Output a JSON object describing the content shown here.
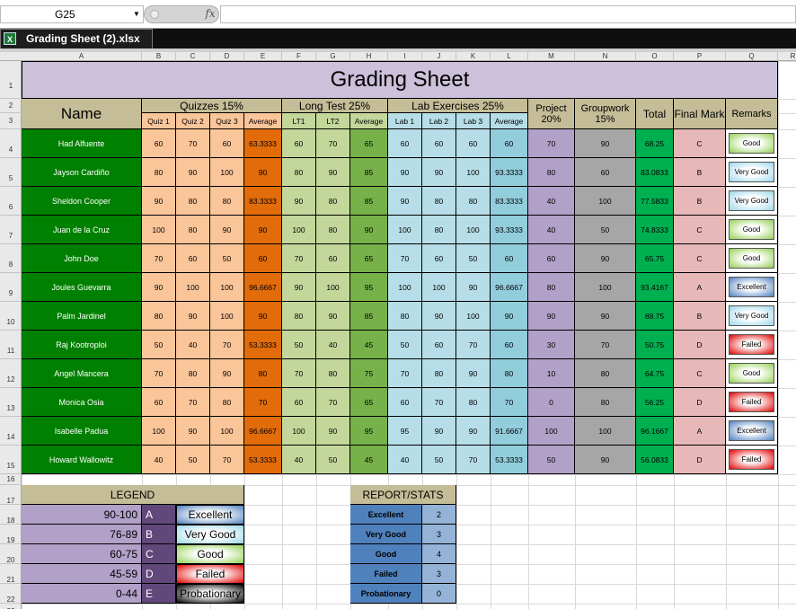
{
  "formula_bar": {
    "name_box": "G25",
    "fx_symbol": "fx",
    "formula": ""
  },
  "tab": {
    "icon": "X",
    "title": "Grading Sheet (2).xlsx"
  },
  "columns": [
    "A",
    "B",
    "C",
    "D",
    "E",
    "F",
    "G",
    "H",
    "I",
    "J",
    "K",
    "L",
    "M",
    "N",
    "O",
    "P",
    "Q",
    "R"
  ],
  "rows": [
    "1",
    "2",
    "3",
    "4",
    "5",
    "6",
    "7",
    "8",
    "9",
    "10",
    "11",
    "12",
    "13",
    "14",
    "15",
    "16",
    "17",
    "18",
    "19",
    "20",
    "21",
    "22",
    "23"
  ],
  "sheet": {
    "title": "Grading Sheet",
    "name_header": "Name",
    "quizzes_header": "Quizzes 15%",
    "long_test_header": "Long Test 25%",
    "lab_header": "Lab Exercises 25%",
    "project_header": "Project",
    "project_pct": "20%",
    "groupwork_header": "Groupwork",
    "groupwork_pct": "15%",
    "total_header": "Total",
    "final_mark_header": "Final Mark",
    "remarks_header": "Remarks",
    "subheaders": [
      "Quiz 1",
      "Quiz 2",
      "Quiz 3",
      "Average",
      "LT1",
      "LT2",
      "Average",
      "Lab 1",
      "Lab 2",
      "Lab 3",
      "Average"
    ],
    "students": [
      {
        "name": "Had Alfuente",
        "q1": "60",
        "q2": "70",
        "q3": "60",
        "qavg": "63.3333",
        "lt1": "60",
        "lt2": "70",
        "ltavg": "65",
        "l1": "60",
        "l2": "60",
        "l3": "60",
        "lavg": "60",
        "proj": "70",
        "gw": "90",
        "total": "68.25",
        "mark": "C",
        "remark": "Good",
        "rclass": "b-good"
      },
      {
        "name": "Jayson Cardiño",
        "q1": "80",
        "q2": "90",
        "q3": "100",
        "qavg": "90",
        "lt1": "80",
        "lt2": "90",
        "ltavg": "85",
        "l1": "90",
        "l2": "90",
        "l3": "100",
        "lavg": "93.3333",
        "proj": "80",
        "gw": "60",
        "total": "83.0833",
        "mark": "B",
        "remark": "Very Good",
        "rclass": "b-vgood"
      },
      {
        "name": "Sheldon Cooper",
        "q1": "90",
        "q2": "80",
        "q3": "80",
        "qavg": "83.3333",
        "lt1": "90",
        "lt2": "80",
        "ltavg": "85",
        "l1": "90",
        "l2": "80",
        "l3": "80",
        "lavg": "83.3333",
        "proj": "40",
        "gw": "100",
        "total": "77.5833",
        "mark": "B",
        "remark": "Very Good",
        "rclass": "b-vgood"
      },
      {
        "name": "Juan de la Cruz",
        "q1": "100",
        "q2": "80",
        "q3": "90",
        "qavg": "90",
        "lt1": "100",
        "lt2": "80",
        "ltavg": "90",
        "l1": "100",
        "l2": "80",
        "l3": "100",
        "lavg": "93.3333",
        "proj": "40",
        "gw": "50",
        "total": "74.8333",
        "mark": "C",
        "remark": "Good",
        "rclass": "b-good"
      },
      {
        "name": "John Doe",
        "q1": "70",
        "q2": "60",
        "q3": "50",
        "qavg": "60",
        "lt1": "70",
        "lt2": "60",
        "ltavg": "65",
        "l1": "70",
        "l2": "60",
        "l3": "50",
        "lavg": "60",
        "proj": "60",
        "gw": "90",
        "total": "65.75",
        "mark": "C",
        "remark": "Good",
        "rclass": "b-good"
      },
      {
        "name": "Joules Guevarra",
        "q1": "90",
        "q2": "100",
        "q3": "100",
        "qavg": "96.6667",
        "lt1": "90",
        "lt2": "100",
        "ltavg": "95",
        "l1": "100",
        "l2": "100",
        "l3": "90",
        "lavg": "96.6667",
        "proj": "80",
        "gw": "100",
        "total": "93.4167",
        "mark": "A",
        "remark": "Excellent",
        "rclass": "b-exc"
      },
      {
        "name": "Palm Jardinel",
        "q1": "80",
        "q2": "90",
        "q3": "100",
        "qavg": "90",
        "lt1": "80",
        "lt2": "90",
        "ltavg": "85",
        "l1": "80",
        "l2": "90",
        "l3": "100",
        "lavg": "90",
        "proj": "90",
        "gw": "90",
        "total": "88.75",
        "mark": "B",
        "remark": "Very Good",
        "rclass": "b-vgood"
      },
      {
        "name": "Raj Kootroploi",
        "q1": "50",
        "q2": "40",
        "q3": "70",
        "qavg": "53.3333",
        "lt1": "50",
        "lt2": "40",
        "ltavg": "45",
        "l1": "50",
        "l2": "60",
        "l3": "70",
        "lavg": "60",
        "proj": "30",
        "gw": "70",
        "total": "50.75",
        "mark": "D",
        "remark": "Failed",
        "rclass": "b-fail"
      },
      {
        "name": "Angel Mancera",
        "q1": "70",
        "q2": "80",
        "q3": "90",
        "qavg": "80",
        "lt1": "70",
        "lt2": "80",
        "ltavg": "75",
        "l1": "70",
        "l2": "80",
        "l3": "90",
        "lavg": "80",
        "proj": "10",
        "gw": "80",
        "total": "64.75",
        "mark": "C",
        "remark": "Good",
        "rclass": "b-good"
      },
      {
        "name": "Monica Osia",
        "q1": "60",
        "q2": "70",
        "q3": "80",
        "qavg": "70",
        "lt1": "60",
        "lt2": "70",
        "ltavg": "65",
        "l1": "60",
        "l2": "70",
        "l3": "80",
        "lavg": "70",
        "proj": "0",
        "gw": "80",
        "total": "56.25",
        "mark": "D",
        "remark": "Failed",
        "rclass": "b-fail"
      },
      {
        "name": "Isabelle Padua",
        "q1": "100",
        "q2": "90",
        "q3": "100",
        "qavg": "96.6667",
        "lt1": "100",
        "lt2": "90",
        "ltavg": "95",
        "l1": "95",
        "l2": "90",
        "l3": "90",
        "lavg": "91.6667",
        "proj": "100",
        "gw": "100",
        "total": "96.1667",
        "mark": "A",
        "remark": "Excellent",
        "rclass": "b-exc"
      },
      {
        "name": "Howard Wallowitz",
        "q1": "40",
        "q2": "50",
        "q3": "70",
        "qavg": "53.3333",
        "lt1": "40",
        "lt2": "50",
        "ltavg": "45",
        "l1": "40",
        "l2": "50",
        "l3": "70",
        "lavg": "53.3333",
        "proj": "50",
        "gw": "90",
        "total": "56.0833",
        "mark": "D",
        "remark": "Failed",
        "rclass": "b-fail"
      }
    ]
  },
  "legend": {
    "title": "LEGEND",
    "items": [
      {
        "range": "90-100",
        "letter": "A",
        "label": "Excellent",
        "bclass": "b-exc"
      },
      {
        "range": "76-89",
        "letter": "B",
        "label": "Very Good",
        "bclass": "b-vgood"
      },
      {
        "range": "60-75",
        "letter": "C",
        "label": "Good",
        "bclass": "b-good"
      },
      {
        "range": "45-59",
        "letter": "D",
        "label": "Failed",
        "bclass": "b-fail"
      },
      {
        "range": "0-44",
        "letter": "E",
        "label": "Probationary",
        "bclass": "b-prob"
      }
    ]
  },
  "report": {
    "title": "REPORT/STATS",
    "items": [
      {
        "label": "Excellent",
        "count": "2"
      },
      {
        "label": "Very Good",
        "count": "3"
      },
      {
        "label": "Good",
        "count": "4"
      },
      {
        "label": "Failed",
        "count": "3"
      },
      {
        "label": "Probationary",
        "count": "0"
      }
    ]
  }
}
